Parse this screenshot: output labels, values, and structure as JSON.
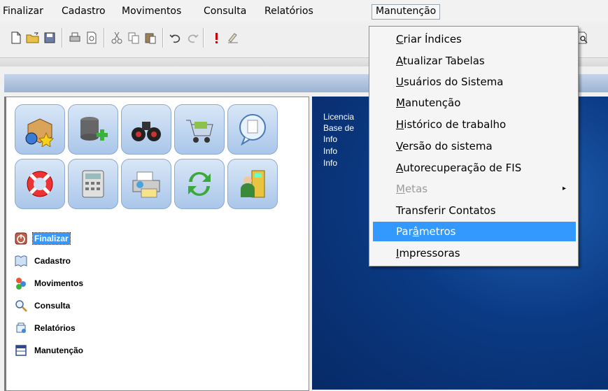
{
  "menubar": {
    "items": [
      "Finalizar",
      "Cadastro",
      "Movimentos",
      "Consulta",
      "Relatórios",
      "Manutenção"
    ],
    "active": "Manutenção"
  },
  "toolbar": {
    "icons": [
      "new-document-icon",
      "open-folder-icon",
      "save-icon",
      "print-icon",
      "print-preview-icon",
      "cut-icon",
      "copy-icon",
      "paste-icon",
      "undo-icon",
      "redo-icon",
      "exclamation-icon",
      "signature-icon",
      "find-icon"
    ]
  },
  "left_panel": {
    "icon_grid": [
      "package-globe-icon",
      "database-add-icon",
      "binoculars-icon",
      "shopping-cart-icon",
      "speech-bubble-icon",
      "lifebuoy-icon",
      "calculator-icon",
      "printer-icon",
      "refresh-arrows-icon",
      "exit-door-icon"
    ],
    "nav": [
      {
        "label": "Finalizar",
        "icon": "power-icon",
        "selected": true
      },
      {
        "label": "Cadastro",
        "icon": "book-icon",
        "selected": false
      },
      {
        "label": "Movimentos",
        "icon": "cubes-icon",
        "selected": false
      },
      {
        "label": "Consulta",
        "icon": "magnifier-icon",
        "selected": false
      },
      {
        "label": "Relatórios",
        "icon": "report-icon",
        "selected": false
      },
      {
        "label": "Manutenção",
        "icon": "window-icon",
        "selected": false
      }
    ]
  },
  "info_panel": {
    "lines": [
      "Licencia",
      "Base de",
      "Info",
      "Info",
      "Info"
    ]
  },
  "dropdown": {
    "items": [
      {
        "pre": "",
        "u": "C",
        "post": "riar Índices",
        "state": "normal"
      },
      {
        "pre": "",
        "u": "A",
        "post": "tualizar Tabelas",
        "state": "normal"
      },
      {
        "pre": "",
        "u": "U",
        "post": "suários do Sistema",
        "state": "normal"
      },
      {
        "pre": "",
        "u": "M",
        "post": "anutenção",
        "state": "normal"
      },
      {
        "pre": "",
        "u": "H",
        "post": "istórico de trabalho",
        "state": "normal"
      },
      {
        "pre": "",
        "u": "V",
        "post": "ersão do sistema",
        "state": "normal"
      },
      {
        "pre": "",
        "u": "A",
        "post": "utorecuperação de FIS",
        "state": "normal"
      },
      {
        "pre": "",
        "u": "M",
        "post": "etas",
        "state": "disabled",
        "submenu": true
      },
      {
        "pre": "",
        "u": "",
        "post": "Transferir Contatos",
        "state": "normal"
      },
      {
        "pre": "Par",
        "u": "â",
        "post": "metros",
        "state": "highlighted"
      },
      {
        "pre": "",
        "u": "I",
        "post": "mpressoras",
        "state": "normal"
      }
    ],
    "submenu_arrow": "▸"
  },
  "colors": {
    "highlight": "#3399ff",
    "blue_panel": "#0b3a84",
    "title_strip": "#9cb3d3"
  }
}
